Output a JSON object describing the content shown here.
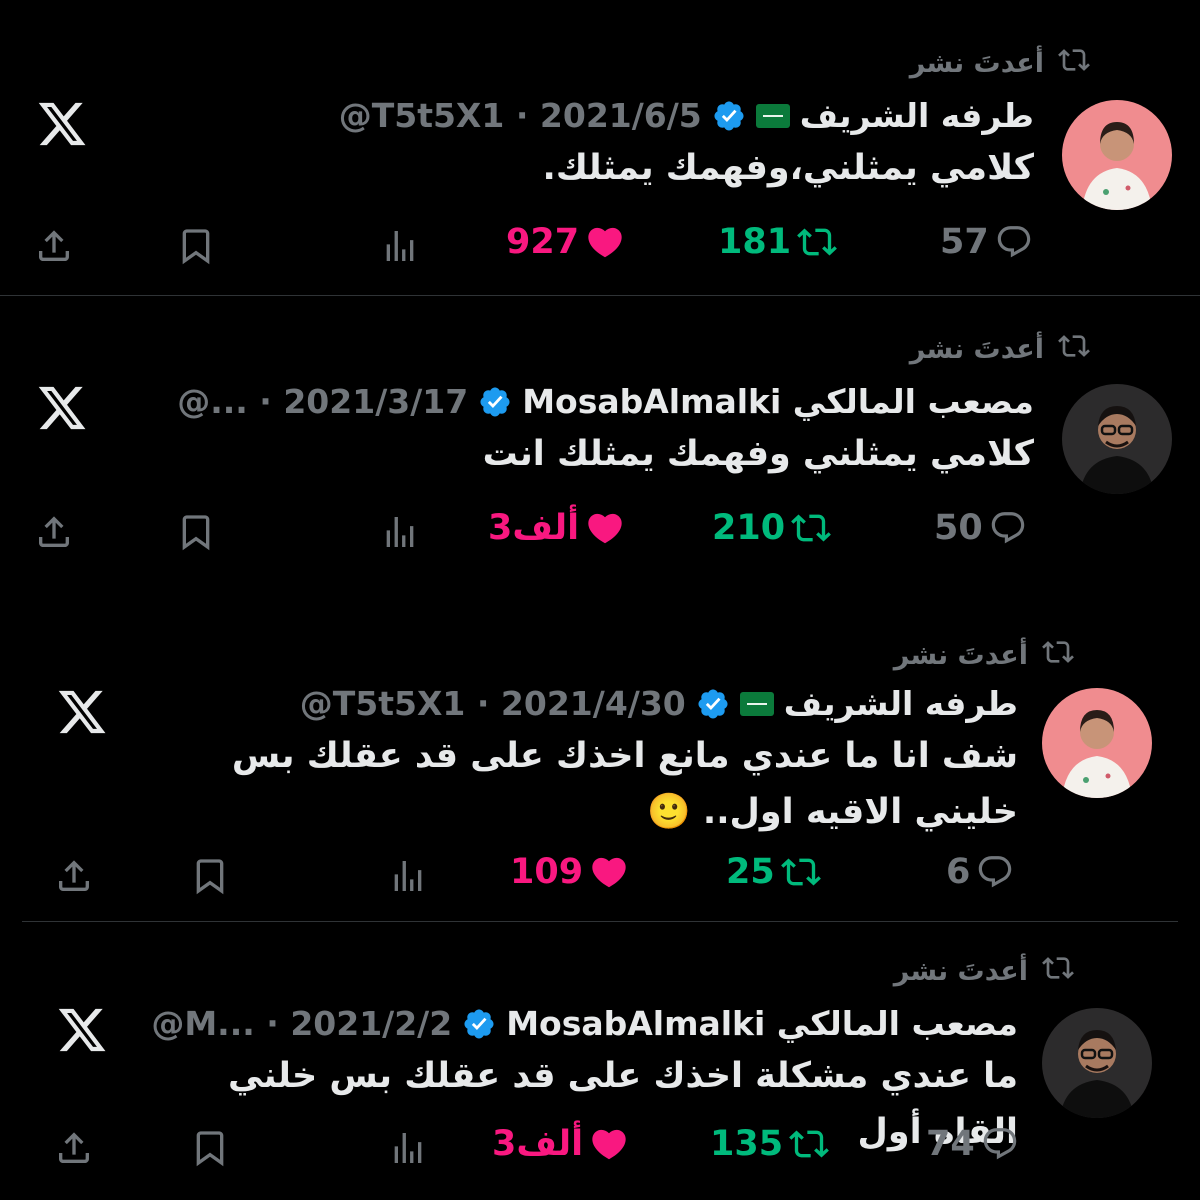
{
  "retweet_label": "أعدتَ نشر",
  "tweets": [
    {
      "display_name": "طرفه الشريف",
      "handle": "@T5t5X1",
      "date": "2021/6/5",
      "text": "كلامي يمثلني،وفهمك يمثلك.",
      "replies": "57",
      "retweets": "181",
      "likes": "927"
    },
    {
      "display_name": "مصعب المالكي MosabAlmalki",
      "handle": "@...",
      "date": "2021/3/17",
      "text": "كلامي يمثلني وفهمك يمثلك انت",
      "replies": "50",
      "retweets": "210",
      "likes": "3ألف"
    },
    {
      "display_name": "طرفه الشريف",
      "handle": "@T5t5X1",
      "date": "2021/4/30",
      "text": "شف انا ما عندي مانع اخذك على قد عقلك بس خليني الاقيه اول.. 🙂",
      "replies": "6",
      "retweets": "25",
      "likes": "109"
    },
    {
      "display_name": "مصعب المالكي MosabAlmalki",
      "handle": "@M...",
      "date": "2021/2/2",
      "text": "ما عندي مشكلة اخذك على قد عقلك بس خلني القاه أول",
      "replies": "74",
      "retweets": "135",
      "likes": "3ألف"
    }
  ],
  "colors": {
    "background": "#000000",
    "muted": "#71767b",
    "retweet_green": "#00ba7c",
    "like_pink": "#f91880",
    "verified_blue": "#1d9bf0",
    "divider": "#2f3336"
  },
  "icons": [
    "retweet-icon",
    "x-logo-icon",
    "verified-badge-icon",
    "saudi-flag-icon",
    "reply-icon",
    "like-icon",
    "views-icon",
    "bookmark-icon",
    "share-icon"
  ]
}
